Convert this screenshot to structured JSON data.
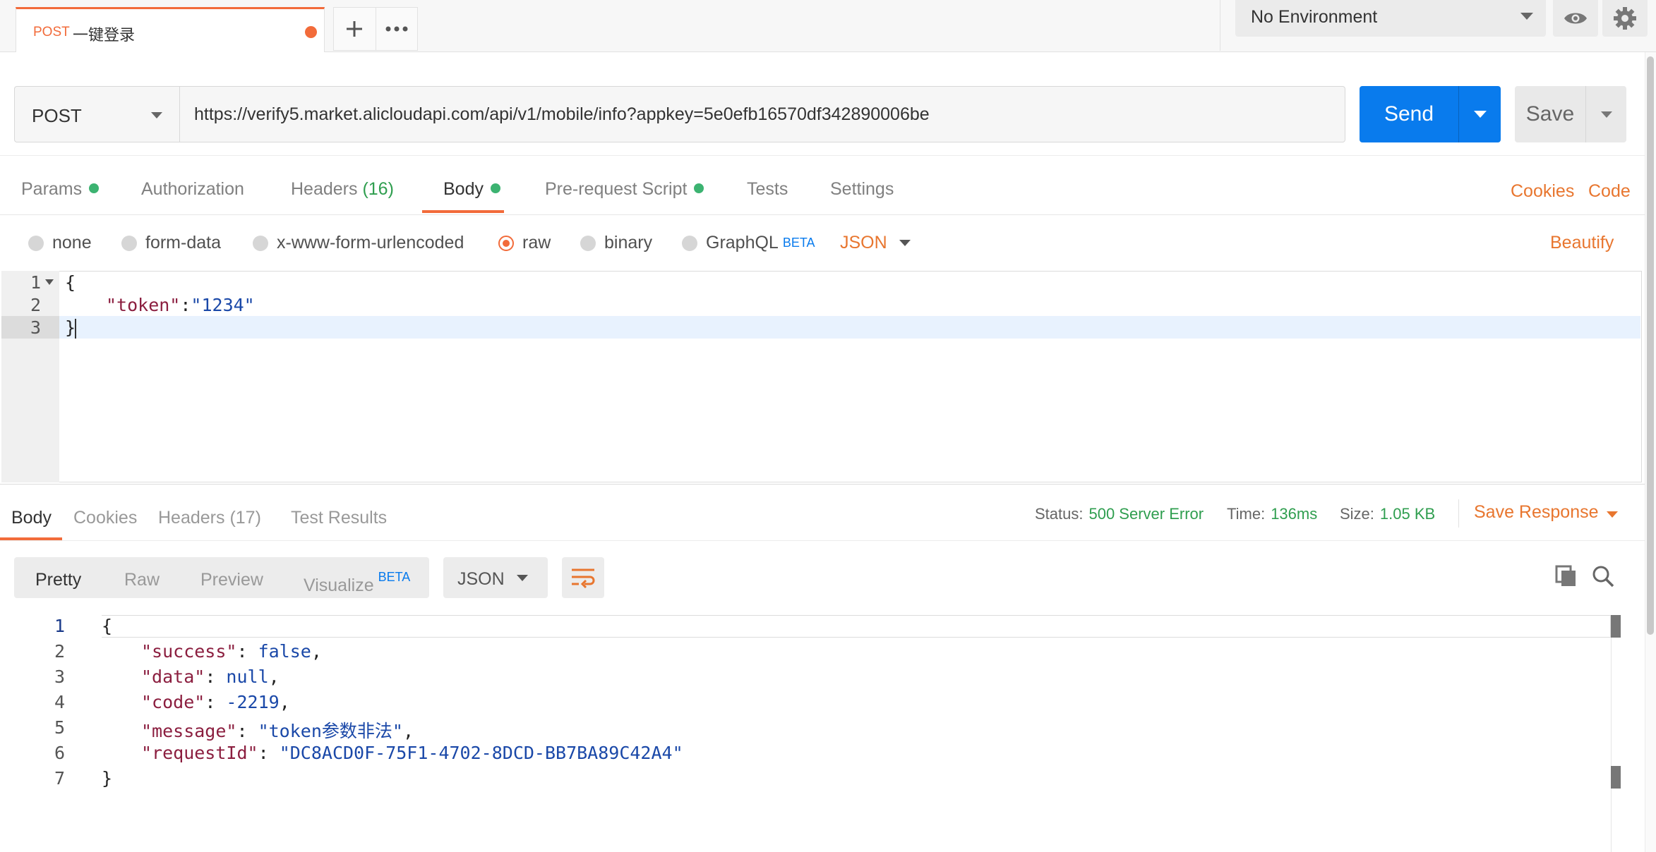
{
  "colors": {
    "accent": "#f26b3a",
    "primary": "#097bed",
    "success": "#2f9e4f",
    "link": "#e8762f"
  },
  "tab": {
    "method": "POST",
    "name": "一键登录"
  },
  "tab_actions": {
    "add_icon": "plus-icon",
    "more_icon": "ellipsis-icon"
  },
  "environment": {
    "selected": "No Environment"
  },
  "request": {
    "method": "POST",
    "url": "https://verify5.market.alicloudapi.com/api/v1/mobile/info?appkey=5e0efb16570df342890006be",
    "send_label": "Send",
    "save_label": "Save"
  },
  "request_tabs": {
    "params": "Params",
    "authorization": "Authorization",
    "headers": "Headers",
    "headers_count": "(16)",
    "body": "Body",
    "prerequest": "Pre-request Script",
    "tests": "Tests",
    "settings": "Settings",
    "cookies": "Cookies",
    "code": "Code"
  },
  "body_types": {
    "none": "none",
    "form_data": "form-data",
    "urlencoded": "x-www-form-urlencoded",
    "raw": "raw",
    "binary": "binary",
    "graphql": "GraphQL",
    "beta": "BETA",
    "selected": "raw",
    "format": "JSON",
    "beautify": "Beautify"
  },
  "request_body": {
    "line_numbers": [
      "1",
      "2",
      "3"
    ],
    "open": "{",
    "key": "\"token\"",
    "colon": ":",
    "value": "\"1234\"",
    "close": "}"
  },
  "response_tabs": {
    "body": "Body",
    "cookies": "Cookies",
    "headers": "Headers",
    "headers_count": "(17)",
    "test_results": "Test Results"
  },
  "status": {
    "status_label": "Status:",
    "status_value": "500 Server Error",
    "time_label": "Time:",
    "time_value": "136ms",
    "size_label": "Size:",
    "size_value": "1.05 KB",
    "save_response": "Save Response"
  },
  "view_modes": {
    "pretty": "Pretty",
    "raw": "Raw",
    "preview": "Preview",
    "visualize": "Visualize",
    "beta": "BETA",
    "format": "JSON"
  },
  "response_body": {
    "line_numbers": [
      "1",
      "2",
      "3",
      "4",
      "5",
      "6",
      "7"
    ],
    "open": "{",
    "lines": [
      {
        "key": "\"success\"",
        "value": "false",
        "trail": ","
      },
      {
        "key": "\"data\"",
        "value": "null",
        "trail": ","
      },
      {
        "key": "\"code\"",
        "value": "-2219",
        "trail": ","
      },
      {
        "key": "\"message\"",
        "value": "\"token参数非法\"",
        "trail": ","
      },
      {
        "key": "\"requestId\"",
        "value": "\"DC8ACD0F-75F1-4702-8DCD-BB7BA89C42A4\"",
        "trail": ""
      }
    ],
    "close": "}"
  }
}
